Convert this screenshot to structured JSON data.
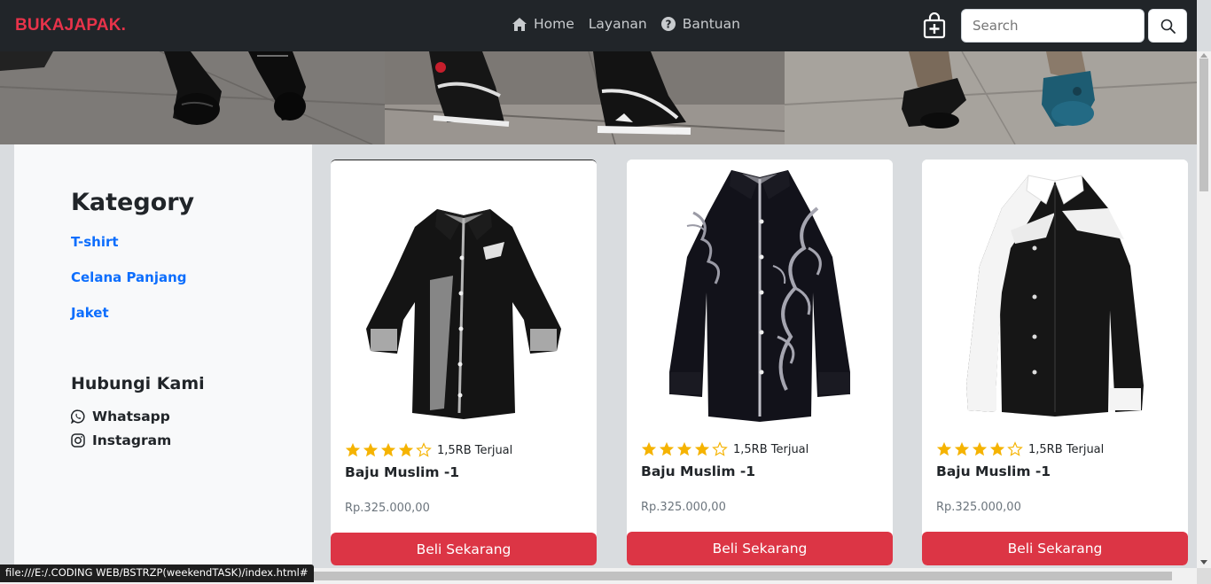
{
  "navbar": {
    "brand": "BUKAJAPAK.",
    "links": [
      {
        "label": "Home",
        "icon": "home-icon"
      },
      {
        "label": "Layanan",
        "icon": ""
      },
      {
        "label": "Bantuan",
        "icon": "question-circle-icon"
      }
    ],
    "cart_icon": "bag-plus-icon",
    "search": {
      "placeholder": "Search",
      "value": ""
    },
    "search_icon": "search-icon"
  },
  "sidebar": {
    "title": "Kategory",
    "categories": [
      "T-shirt",
      "Celana Panjang",
      "Jaket"
    ],
    "contact_title": "Hubungi Kami",
    "contacts": [
      {
        "label": "Whatsapp",
        "icon": "whatsapp-icon"
      },
      {
        "label": "Instagram",
        "icon": "instagram-icon"
      }
    ]
  },
  "products": [
    {
      "name": "Baju Muslim -1",
      "rating": 4,
      "max_rating": 5,
      "sold": "1,5RB Terjual",
      "price": "Rp.325.000,00",
      "button": "Beli Sekarang"
    },
    {
      "name": "Baju Muslim -1",
      "rating": 4,
      "max_rating": 5,
      "sold": "1,5RB Terjual",
      "price": "Rp.325.000,00",
      "button": "Beli Sekarang"
    },
    {
      "name": "Baju Muslim -1",
      "rating": 4,
      "max_rating": 5,
      "sold": "1,5RB Terjual",
      "price": "Rp.325.000,00",
      "button": "Beli Sekarang"
    }
  ],
  "status_bar": "file:///E:/.CODING WEB/BSTRZP(weekendTASK)/index.html#",
  "colors": {
    "brand": "#e8334a",
    "navbar_bg": "#212529",
    "link": "#0d6efd",
    "buy_button": "#dc3545",
    "star": "#f5b301"
  }
}
